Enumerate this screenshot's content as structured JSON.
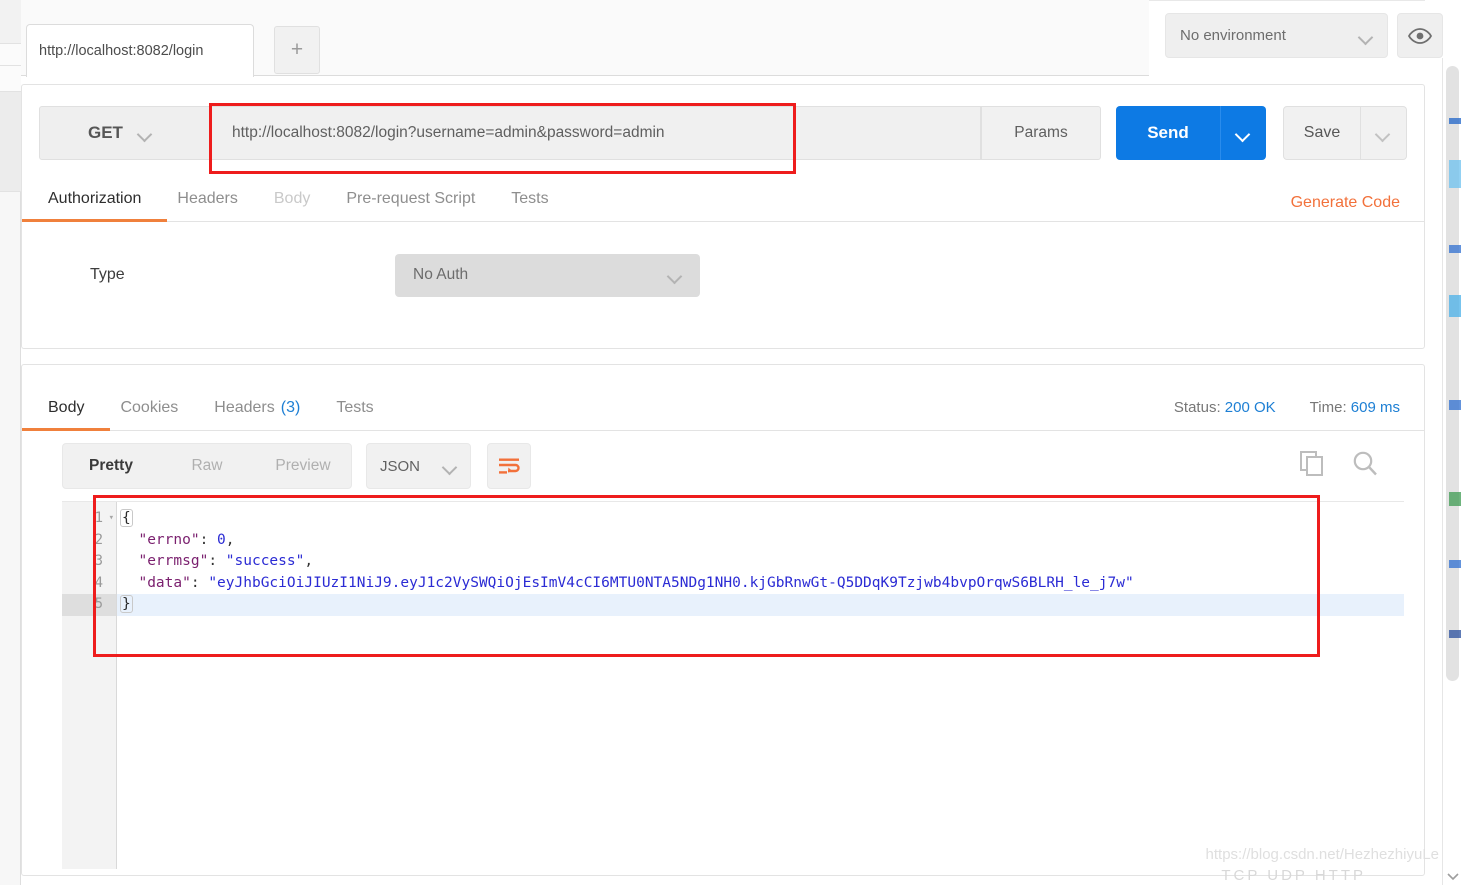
{
  "window": {
    "request_tab_label": "http://localhost:8082/login",
    "new_tab_icon": "plus-icon",
    "environment_selected": "No environment",
    "eye_icon": "eye-icon"
  },
  "request": {
    "method": "GET",
    "url": "http://localhost:8082/login?username=admin&password=admin",
    "params_label": "Params",
    "send_label": "Send",
    "save_label": "Save",
    "send_color": "#0d7ae4",
    "tabs": [
      {
        "label": "Authorization",
        "active": true,
        "dim": false
      },
      {
        "label": "Headers",
        "active": false,
        "dim": false
      },
      {
        "label": "Body",
        "active": false,
        "dim": true
      },
      {
        "label": "Pre-request Script",
        "active": false,
        "dim": false
      },
      {
        "label": "Tests",
        "active": false,
        "dim": false
      }
    ],
    "generate_code_label": "Generate Code",
    "auth": {
      "type_label": "Type",
      "type_value": "No Auth"
    }
  },
  "response": {
    "tabs": [
      {
        "label": "Body",
        "active": true,
        "count": ""
      },
      {
        "label": "Cookies",
        "active": false,
        "count": ""
      },
      {
        "label": "Headers",
        "active": false,
        "count": "(3)"
      },
      {
        "label": "Tests",
        "active": false,
        "count": ""
      }
    ],
    "status_label": "Status:",
    "status_value": "200 OK",
    "time_label": "Time:",
    "time_value": "609 ms",
    "view_modes": [
      {
        "label": "Pretty",
        "active": true
      },
      {
        "label": "Raw",
        "active": false
      },
      {
        "label": "Preview",
        "active": false
      }
    ],
    "format": "JSON",
    "wrap_icon": "word-wrap-icon",
    "copy_icon": "copy-icon",
    "search_icon": "search-icon",
    "line_numbers": [
      "1",
      "2",
      "3",
      "4",
      "5"
    ],
    "highlight_line": 5,
    "body_lines": [
      {
        "n": "1",
        "indent": 0,
        "tokens": [
          {
            "t": "brace",
            "v": "{"
          }
        ]
      },
      {
        "n": "2",
        "indent": 1,
        "tokens": [
          {
            "t": "k",
            "v": "\"errno\""
          },
          {
            "t": "p",
            "v": ": "
          },
          {
            "t": "n",
            "v": "0"
          },
          {
            "t": "p",
            "v": ","
          }
        ]
      },
      {
        "n": "3",
        "indent": 1,
        "tokens": [
          {
            "t": "k",
            "v": "\"errmsg\""
          },
          {
            "t": "p",
            "v": ": "
          },
          {
            "t": "s",
            "v": "\"success\""
          },
          {
            "t": "p",
            "v": ","
          }
        ]
      },
      {
        "n": "4",
        "indent": 1,
        "tokens": [
          {
            "t": "k",
            "v": "\"data\""
          },
          {
            "t": "p",
            "v": ": "
          },
          {
            "t": "s",
            "v": "\"eyJhbGciOiJIUzI1NiJ9.eyJ1c2VySWQiOjEsImV4cCI6MTU0NTA5NDg1NH0.kjGbRnwGt-Q5DDqK9Tzjwb4bvpOrqwS6BLRH_le_j7w\""
          }
        ]
      },
      {
        "n": "5",
        "indent": 0,
        "tokens": [
          {
            "t": "brace",
            "v": "}"
          }
        ]
      }
    ],
    "parsed": {
      "errno": 0,
      "errmsg": "success",
      "data": "eyJhbGciOiJIUzI1NiJ9.eyJ1c2VySWQiOjEsImV4cCI6MTU0NTA5NDg1NH0.kjGbRnwGt-Q5DDqK9Tzjwb4bvpOrqwS6BLRH_le_j7w"
    }
  },
  "annotations": {
    "color": "#ee1c1c",
    "url_box_note": "url-highlight",
    "body_box_note": "response-body-highlight"
  },
  "watermark": {
    "text": "https://blog.csdn.net/HezhezhiyuLe",
    "footer_ghost": "TCP UDP HTTP"
  }
}
